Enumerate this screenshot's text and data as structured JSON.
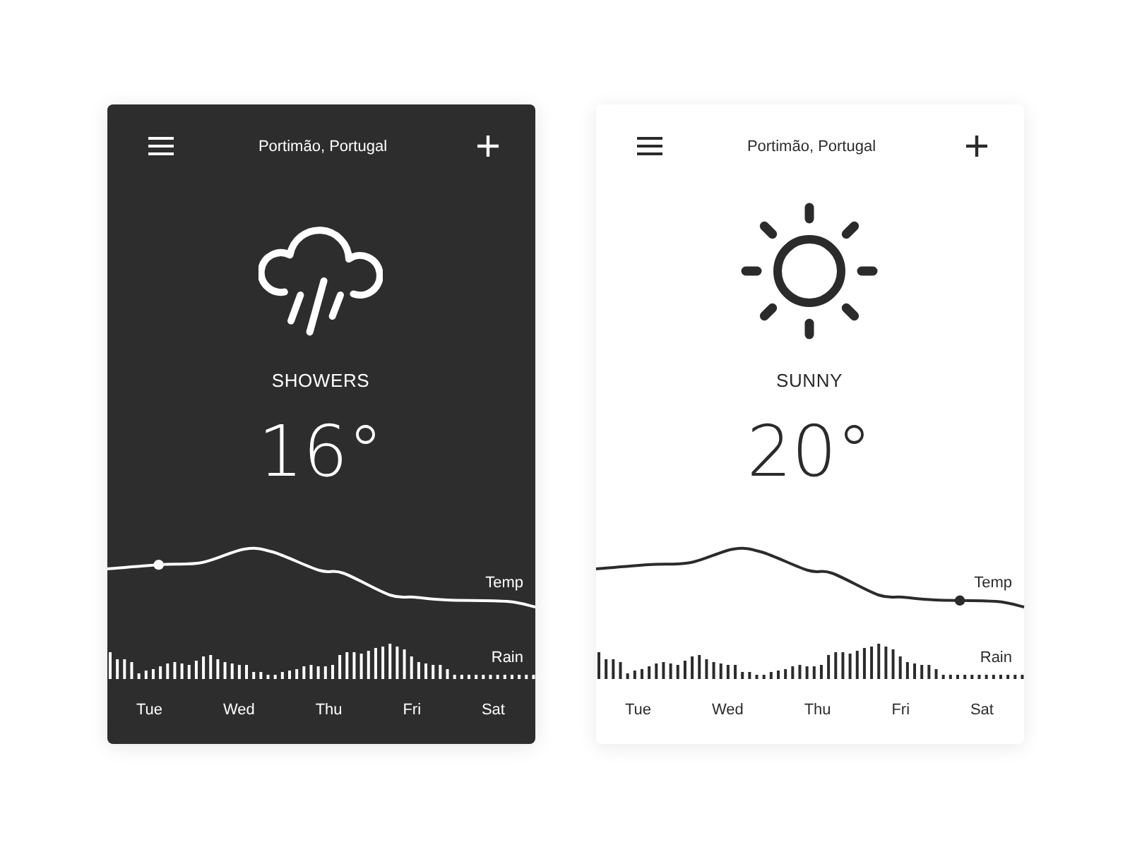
{
  "cards": [
    {
      "kind": "dark",
      "header": {
        "title": "Portimão, Portugal"
      },
      "weather": {
        "kind": "showers",
        "condition": "SHOWERS",
        "temperature": "16°"
      },
      "temp_chart": {
        "label": "Temp",
        "marker": {
          "level": 0.12
        }
      },
      "rain_chart": {
        "label": "Rain"
      },
      "days": [
        "Tue",
        "Wed",
        "Thu",
        "Fri",
        "Sat"
      ]
    },
    {
      "kind": "light",
      "header": {
        "title": "Portimão, Portugal"
      },
      "weather": {
        "kind": "sunny",
        "condition": "SUNNY",
        "temperature": "20°"
      },
      "temp_chart": {
        "label": "Temp",
        "marker": {
          "level": 0.85
        }
      },
      "rain_chart": {
        "label": "Rain"
      },
      "days": [
        "Tue",
        "Wed",
        "Thu",
        "Fri",
        "Sat"
      ]
    }
  ]
}
